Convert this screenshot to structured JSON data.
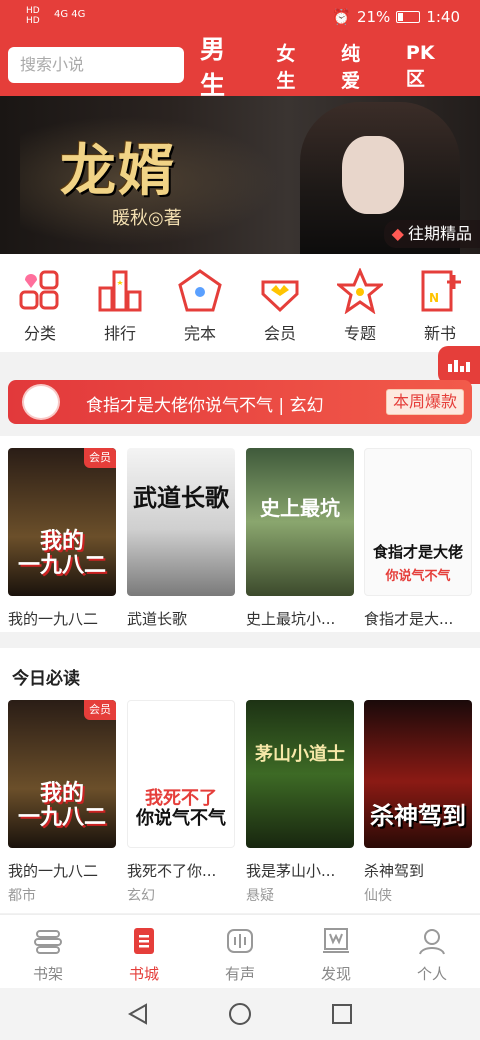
{
  "status_bar": {
    "sim": "HD\nHD",
    "signal": "4G 4G",
    "battery": "21%",
    "time": "1:40"
  },
  "header": {
    "search_placeholder": "搜索小说",
    "tabs": [
      {
        "label": "男生",
        "active": true
      },
      {
        "label": "女生",
        "active": false
      },
      {
        "label": "纯爱",
        "active": false
      },
      {
        "label": "PK区",
        "active": false
      }
    ]
  },
  "banner": {
    "title": "龙婿",
    "author": "暖秋◎著",
    "past_label": "往期精品",
    "slide_count": 10,
    "current_slide": 9
  },
  "categories": [
    {
      "label": "分类",
      "icon": "category-grid-icon"
    },
    {
      "label": "排行",
      "icon": "ranking-bars-icon"
    },
    {
      "label": "完本",
      "icon": "finished-pentagon-icon"
    },
    {
      "label": "会员",
      "icon": "vip-crown-icon"
    },
    {
      "label": "专题",
      "icon": "topic-star-icon"
    },
    {
      "label": "新书",
      "icon": "new-book-icon"
    }
  ],
  "hot_banner": {
    "text": "食指才是大佬你说气不气 | 玄幻",
    "badge": "本周爆款"
  },
  "row1": [
    {
      "name": "我的一九八二",
      "vip": "会员",
      "cover_text": "我的\n一九八二"
    },
    {
      "name": "武道长歌",
      "vip": "",
      "cover_text": "武道长歌"
    },
    {
      "name": "史上最坑小...",
      "vip": "",
      "cover_text": "史上最坑"
    },
    {
      "name": "食指才是大...",
      "vip": "",
      "cover_text": "食指才是大佬"
    }
  ],
  "section2": {
    "title": "今日必读",
    "books": [
      {
        "name": "我的一九八二",
        "genre": "都市",
        "vip": "会员",
        "cover_text": "我的\n一九八二"
      },
      {
        "name": "我死不了你...",
        "genre": "玄幻",
        "vip": "",
        "cover_text": "我死不了\n你说气不气"
      },
      {
        "name": "我是茅山小...",
        "genre": "悬疑",
        "vip": "",
        "cover_text": "茅山小道士"
      },
      {
        "name": "杀神驾到",
        "genre": "仙侠",
        "vip": "",
        "cover_text": "杀神驾到"
      }
    ]
  },
  "bottom_nav": [
    {
      "label": "书架",
      "active": false
    },
    {
      "label": "书城",
      "active": true
    },
    {
      "label": "有声",
      "active": false
    },
    {
      "label": "发现",
      "active": false
    },
    {
      "label": "个人",
      "active": false
    }
  ],
  "colors": {
    "brand_red": "#e53e3a",
    "text_dark": "#333333",
    "text_muted": "#999999"
  }
}
